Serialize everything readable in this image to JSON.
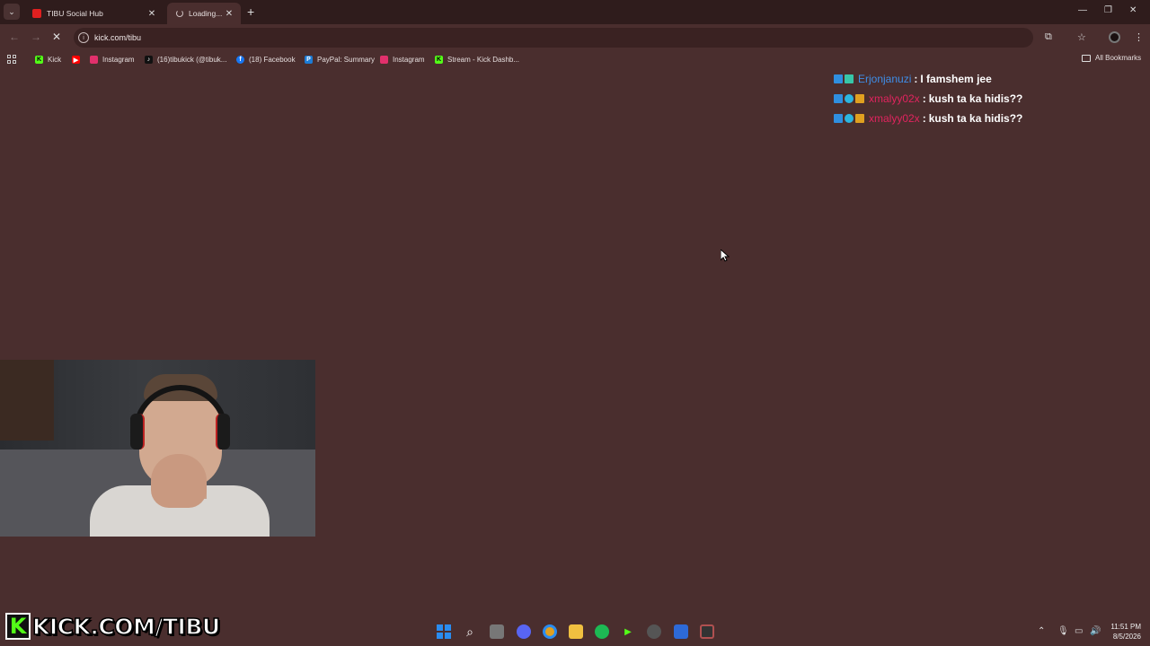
{
  "browser": {
    "tabs": [
      {
        "label": "TIBU Social Hub",
        "favicon_color": "#e02020"
      },
      {
        "label": "Loading..."
      }
    ],
    "address": "kick.com/tibu",
    "bookmarks": [
      {
        "label": "Kick",
        "icon": "kick-icon",
        "color": "#53fc18"
      },
      {
        "label": "",
        "icon": "youtube-icon",
        "color": "#ff0000"
      },
      {
        "label": "Instagram",
        "icon": "instagram-icon",
        "color": "#e1306c"
      },
      {
        "label": "(16)tibukick (@tibuk...",
        "icon": "tiktok-icon",
        "color": "#111111"
      },
      {
        "label": "(18) Facebook",
        "icon": "facebook-icon",
        "color": "#1877f2"
      },
      {
        "label": "PayPal: Summary",
        "icon": "paypal-icon",
        "color": "#1c7cd6"
      },
      {
        "label": "Instagram",
        "icon": "instagram-icon",
        "color": "#e1306c"
      },
      {
        "label": "Stream - Kick Dashb...",
        "icon": "kick-icon",
        "color": "#53fc18"
      }
    ],
    "all_bookmarks": "All Bookmarks"
  },
  "chat": [
    {
      "user": "Erjonjanuzi",
      "separator": ":",
      "message": "I famshem jee",
      "user_color": "#3e8ee8"
    },
    {
      "user": "xmalyy02x",
      "separator": ":",
      "message": "kush ta ka hidis??",
      "user_color": "#e0245e"
    },
    {
      "user": "xmalyy02x",
      "separator": ":",
      "message": "kush ta ka hidis??",
      "user_color": "#e0245e"
    }
  ],
  "overlay": {
    "brand_letter": "K",
    "brand_text": "KICK.COM/TIBU"
  },
  "taskbar": {
    "apps": [
      {
        "icon": "windows-start-icon",
        "color": "#2a8cf0"
      },
      {
        "icon": "search-icon",
        "color": "transparent"
      },
      {
        "icon": "task-view-icon",
        "color": "#777777"
      },
      {
        "icon": "discord-icon",
        "color": "#5865f2"
      },
      {
        "icon": "chrome-icon",
        "color": "#e0a020"
      },
      {
        "icon": "file-explorer-icon",
        "color": "#f0c040"
      },
      {
        "icon": "spotify-icon",
        "color": "#1db954"
      },
      {
        "icon": "kick-studio-icon",
        "color": "#53fc18"
      },
      {
        "icon": "steam-icon",
        "color": "#555555"
      },
      {
        "icon": "editor-icon",
        "color": "#2d6ad8"
      },
      {
        "icon": "obs-icon",
        "color": "#333333"
      }
    ],
    "time": "11:51 PM",
    "date": "8/5/2026"
  }
}
